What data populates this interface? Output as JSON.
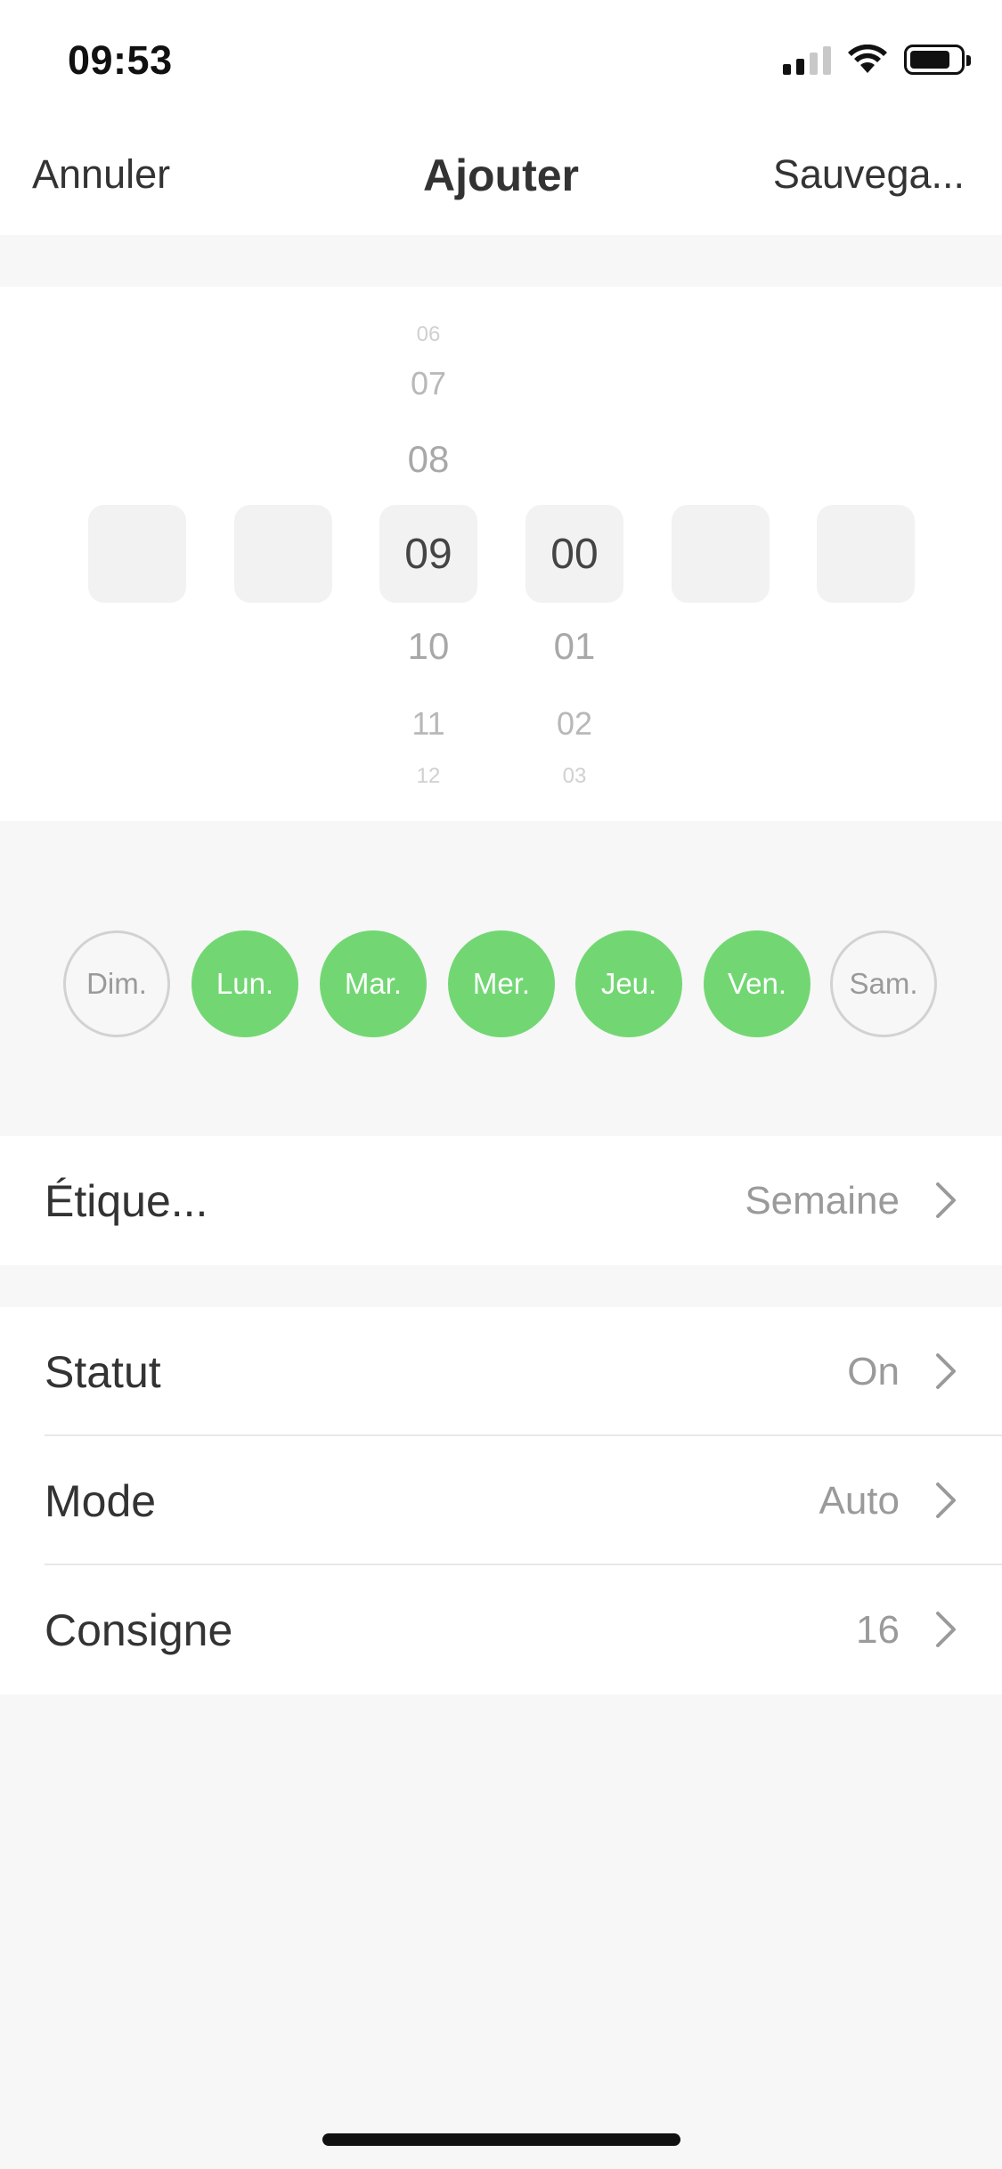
{
  "status_bar": {
    "time": "09:53"
  },
  "nav": {
    "cancel": "Annuler",
    "title": "Ajouter",
    "save": "Sauvega..."
  },
  "picker": {
    "hours": {
      "n3_above": "06",
      "n2_above": "07",
      "n1_above": "08",
      "selected": "09",
      "n1_below": "10",
      "n2_below": "11",
      "n3_below": "12"
    },
    "minutes": {
      "selected": "00",
      "n1_below": "01",
      "n2_below": "02",
      "n3_below": "03"
    }
  },
  "days": [
    {
      "label": "Dim.",
      "active": false
    },
    {
      "label": "Lun.",
      "active": true
    },
    {
      "label": "Mar.",
      "active": true
    },
    {
      "label": "Mer.",
      "active": true
    },
    {
      "label": "Jeu.",
      "active": true
    },
    {
      "label": "Ven.",
      "active": true
    },
    {
      "label": "Sam.",
      "active": false
    }
  ],
  "label_row": {
    "label": "Étique...",
    "value": "Semaine"
  },
  "settings": [
    {
      "label": "Statut",
      "value": "On"
    },
    {
      "label": "Mode",
      "value": "Auto"
    },
    {
      "label": "Consigne",
      "value": "16"
    }
  ],
  "colors": {
    "active_day": "#72d773",
    "background": "#f7f7f7"
  }
}
